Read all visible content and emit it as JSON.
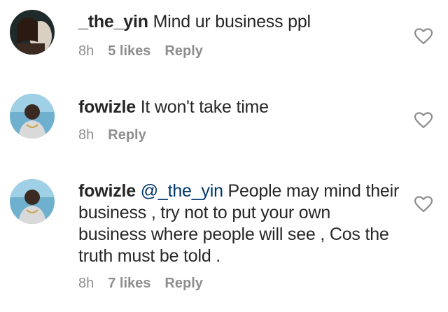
{
  "comments": [
    {
      "username": "_the_yin",
      "mention": "",
      "text": "Mind ur business ppl",
      "time": "8h",
      "likes": "5 likes",
      "reply": "Reply"
    },
    {
      "username": "fowizle",
      "mention": "",
      "text": "It won't take time",
      "time": "8h",
      "likes": "",
      "reply": "Reply"
    },
    {
      "username": "fowizle",
      "mention": "@_the_yin",
      "text": "People may mind their business , try not to put your own business where people will see , Cos the truth must be told .",
      "time": "8h",
      "likes": "7 likes",
      "reply": "Reply"
    }
  ],
  "icons": {
    "like": "heart-outline-icon",
    "avatar_1": "profile-photo",
    "avatar_2": "profile-photo",
    "avatar_3": "profile-photo"
  },
  "colors": {
    "text": "#262626",
    "meta": "#8e8e8e",
    "mention": "#003569"
  }
}
